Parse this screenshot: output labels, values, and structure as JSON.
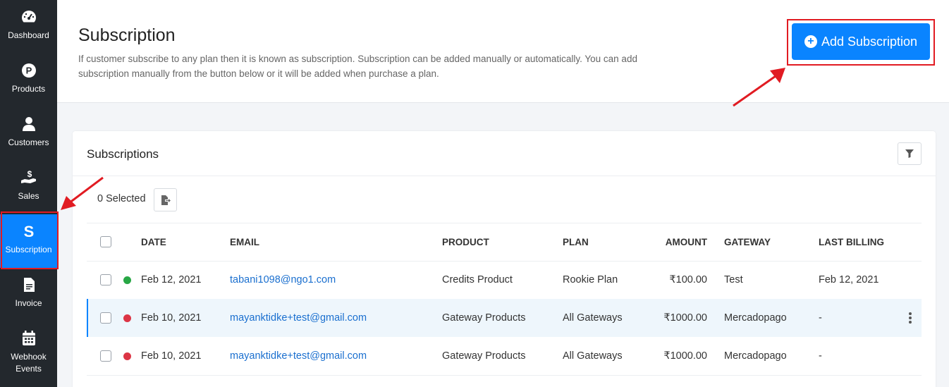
{
  "sidebar": {
    "items": [
      {
        "label": "Dashboard",
        "icon": "dashboard-icon"
      },
      {
        "label": "Products",
        "icon": "product-icon"
      },
      {
        "label": "Customers",
        "icon": "user-icon"
      },
      {
        "label": "Sales",
        "icon": "sales-icon"
      },
      {
        "label": "Subscription",
        "icon": "subscription-icon",
        "active": true
      },
      {
        "label": "Invoice",
        "icon": "invoice-icon"
      },
      {
        "label": "Webhook Events",
        "icon": "calendar-icon"
      }
    ]
  },
  "header": {
    "title": "Subscription",
    "description": "If customer subscribe to any plan then it is known as subscription. Subscription can be added manually or automatically. You can add subscription manually from the button below or it will be added when purchase a plan.",
    "add_button_label": "Add Subscription",
    "add_button_icon": "plus-circle-icon"
  },
  "card": {
    "title": "Subscriptions",
    "selected_text": "0 Selected",
    "filter_icon": "filter-icon",
    "export_icon": "export-icon"
  },
  "table": {
    "headers": {
      "date": "DATE",
      "email": "EMAIL",
      "product": "PRODUCT",
      "plan": "PLAN",
      "amount": "AMOUNT",
      "gateway": "GATEWAY",
      "last_billing": "LAST BILLING"
    },
    "rows": [
      {
        "status_color": "#28a745",
        "date": "Feb 12, 2021",
        "email": "tabani1098@ngo1.com",
        "product": "Credits Product",
        "plan": "Rookie Plan",
        "amount": "₹100.00",
        "gateway": "Test",
        "last_billing": "Feb 12, 2021"
      },
      {
        "status_color": "#dc3545",
        "date": "Feb 10, 2021",
        "email": "mayanktidke+test@gmail.com",
        "product": "Gateway Products",
        "plan": "All Gateways",
        "amount": "₹1000.00",
        "gateway": "Mercadopago",
        "last_billing": "-"
      },
      {
        "status_color": "#dc3545",
        "date": "Feb 10, 2021",
        "email": "mayanktidke+test@gmail.com",
        "product": "Gateway Products",
        "plan": "All Gateways",
        "amount": "₹1000.00",
        "gateway": "Mercadopago",
        "last_billing": "-"
      }
    ]
  },
  "colors": {
    "accent": "#0a84ff",
    "sidebar_bg": "#23282d",
    "annotation_red": "#e11b22"
  }
}
